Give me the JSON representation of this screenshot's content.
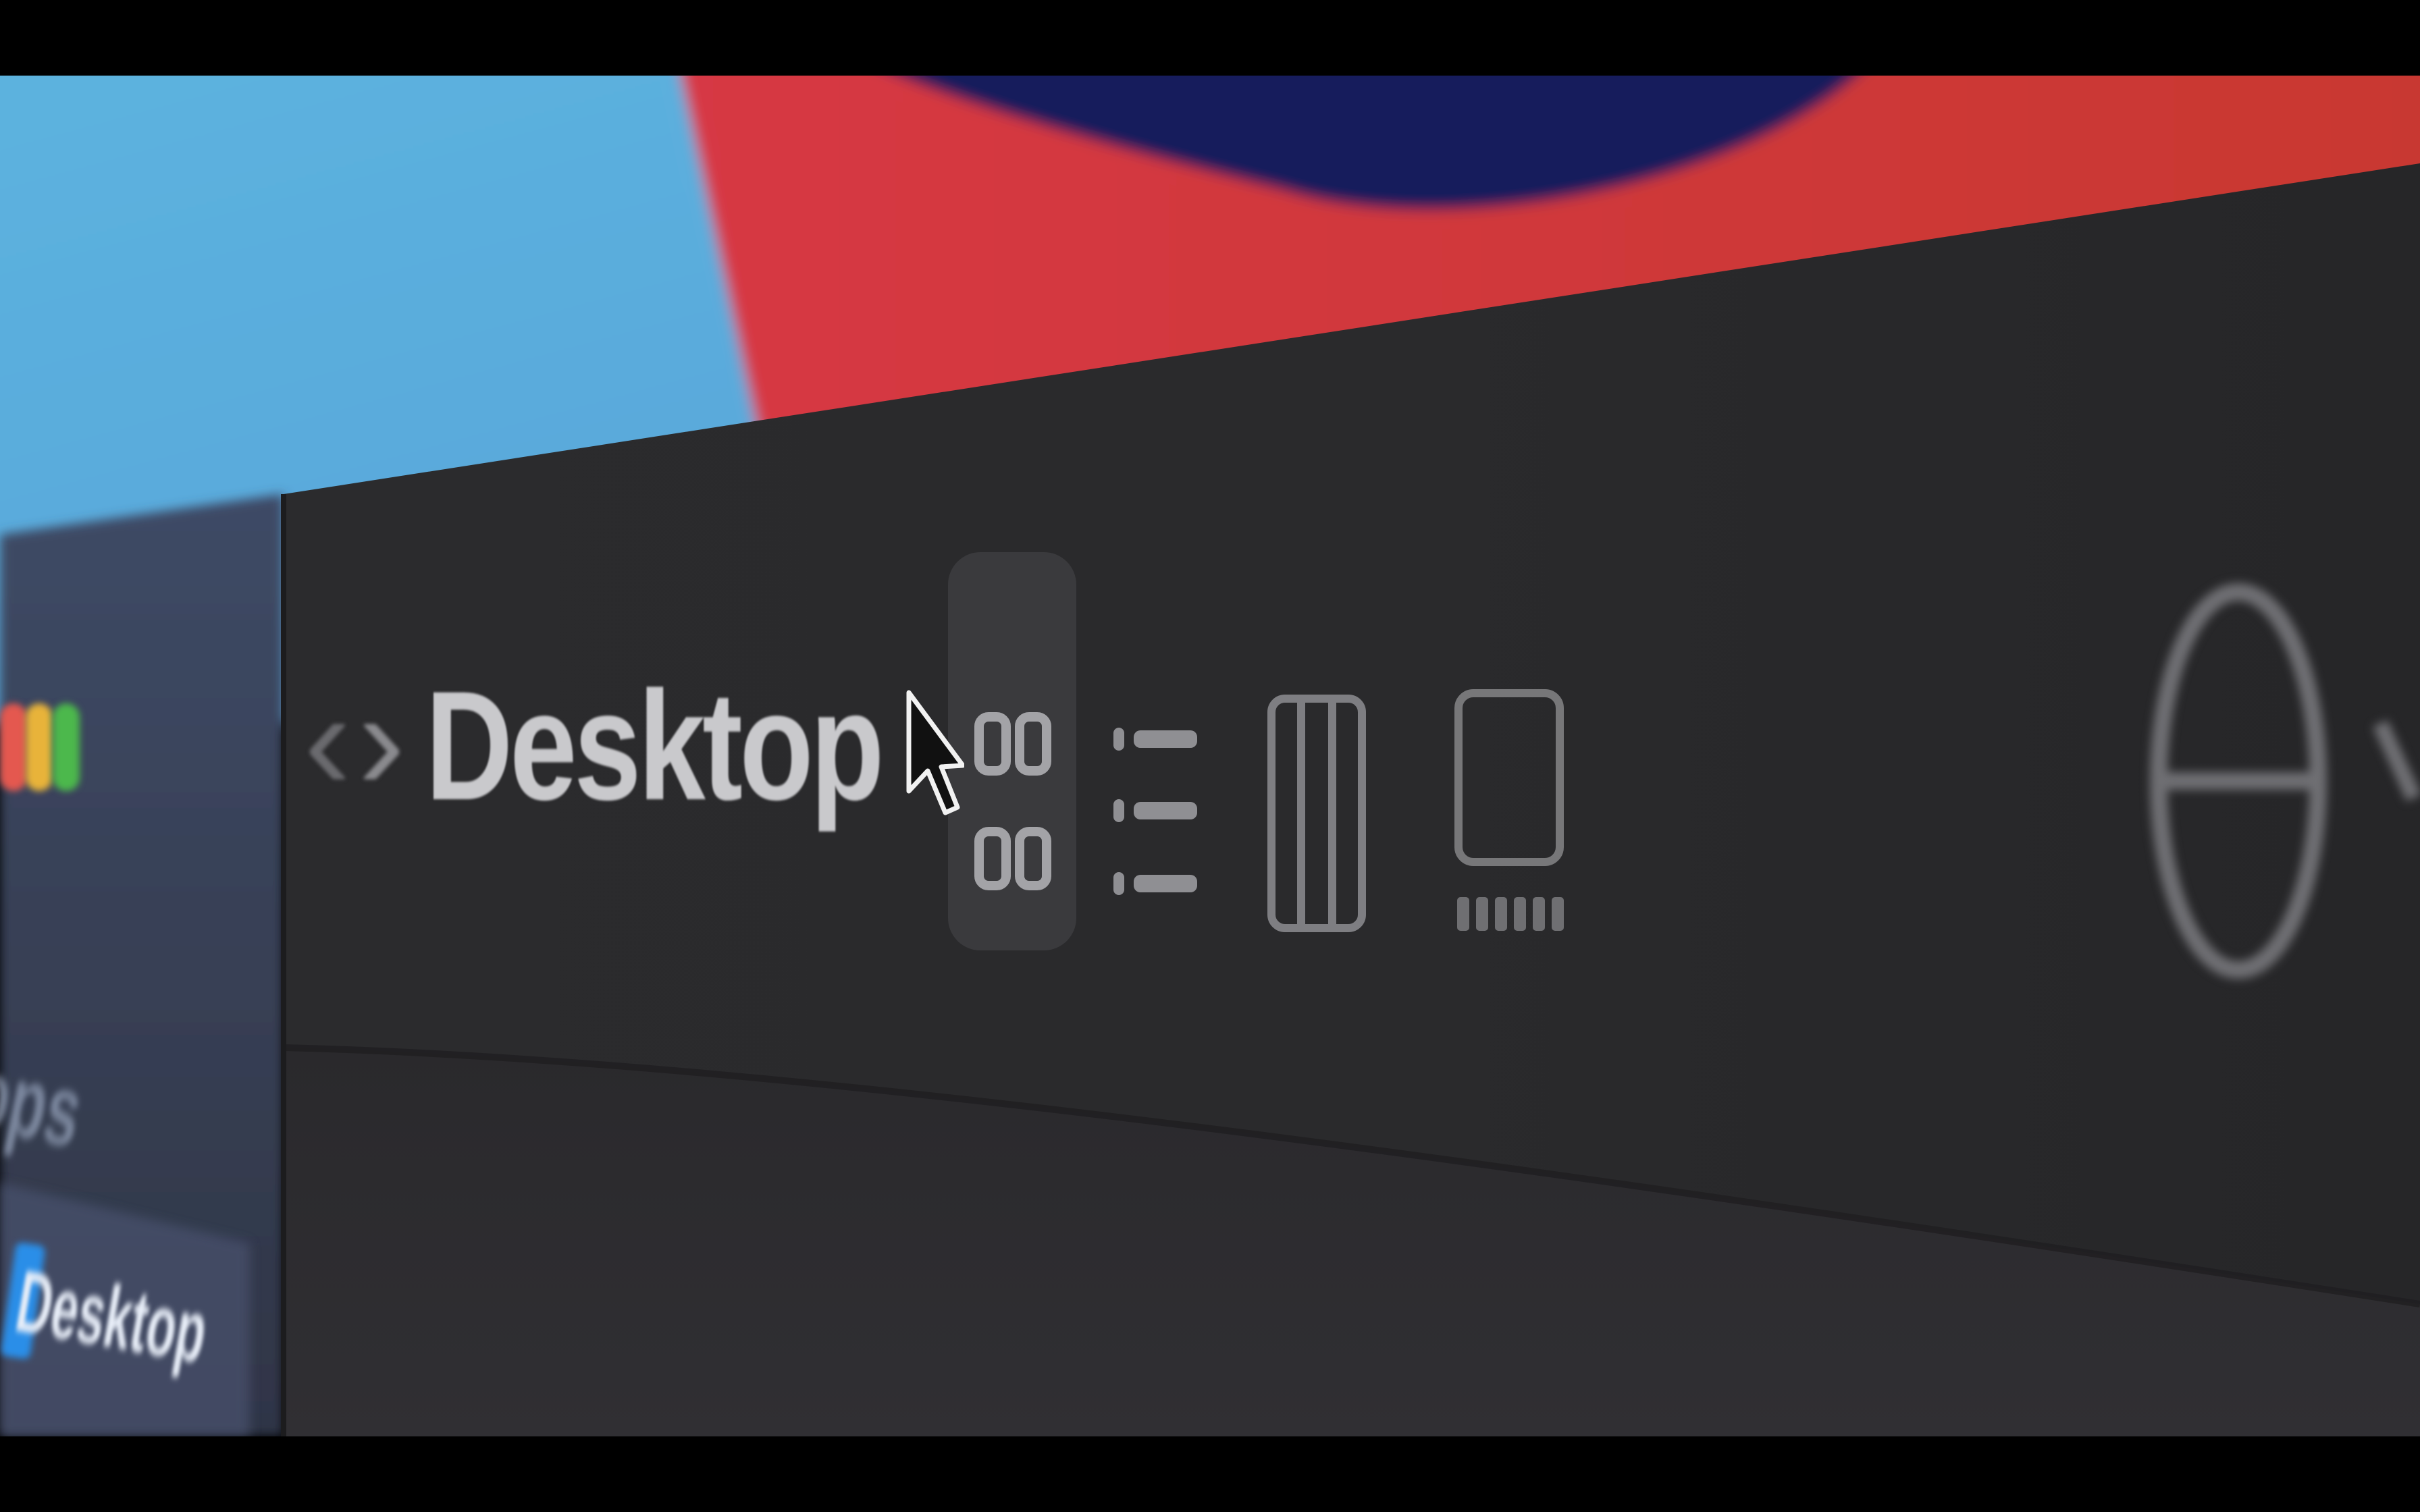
{
  "window": {
    "title": "Desktop"
  },
  "sidebar": {
    "partial_item_label": "ops",
    "selected_item_label": "Desktop"
  },
  "toolbar": {
    "back_label": "‹",
    "forward_label": "›",
    "view_modes": [
      {
        "name": "icons",
        "selected": true
      },
      {
        "name": "list",
        "selected": false
      },
      {
        "name": "columns",
        "selected": false
      },
      {
        "name": "gallery",
        "selected": false
      }
    ],
    "action_icon": "action-menu-icon"
  },
  "colors": {
    "wallpaper_blue": "#57aee0",
    "wallpaper_red": "#d6383f",
    "wallpaper_navy": "#16195a",
    "toolbar_bg": "#2a2a2c",
    "selected_view_bg": "#3a3a3d",
    "icon_color": "#9a9a9e",
    "traffic_red": "#e4584f",
    "traffic_yellow": "#e8b33a",
    "traffic_green": "#4cb84c",
    "folder_blue": "#2a8ee8"
  }
}
